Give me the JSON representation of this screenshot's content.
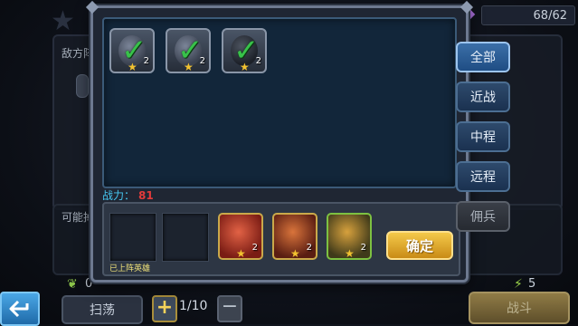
{
  "background": {
    "enemy_label": "敌方阵",
    "possible_label": "可能掉",
    "stamina": "68/62",
    "count_left": "0",
    "count_right": "5"
  },
  "bottom": {
    "back_icon": "back-arrow-icon",
    "sweep_label": "扫荡",
    "sweep_count": "1/10",
    "fight_label": "战斗"
  },
  "modal": {
    "pool_heroes": [
      {
        "level": "2",
        "status": "selected"
      },
      {
        "level": "2",
        "status": "selected"
      },
      {
        "level": "2",
        "status": "selected"
      }
    ],
    "power_label": "战力：",
    "power_value": "81",
    "deploy_hint": "已上阵英雄",
    "deployed_heroes": [
      {
        "level": "2",
        "color": "red"
      },
      {
        "level": "2",
        "color": "orange"
      },
      {
        "level": "2",
        "color": "gold"
      }
    ],
    "confirm_label": "确定"
  },
  "tabs": [
    "全部",
    "近战",
    "中程",
    "远程",
    "佣兵"
  ]
}
